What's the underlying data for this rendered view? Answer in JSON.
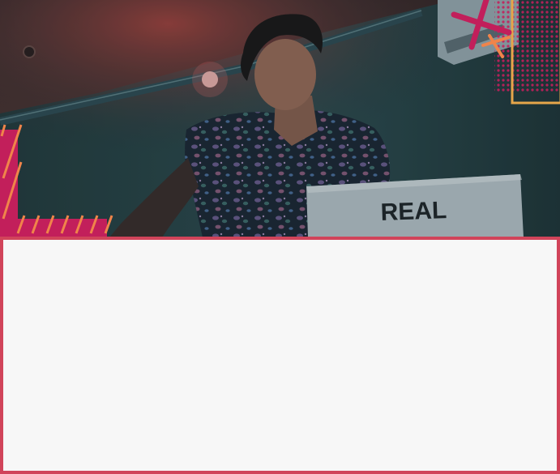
{
  "hero": {
    "laptop_sticker_text": "REAL"
  },
  "card": {
    "content": ""
  },
  "colors": {
    "accent": "#d1445a",
    "accent_orange": "#f0844a",
    "accent_gold": "#e6a64a",
    "magenta": "#c21f5b",
    "panel_bg": "#f7f7f7"
  }
}
